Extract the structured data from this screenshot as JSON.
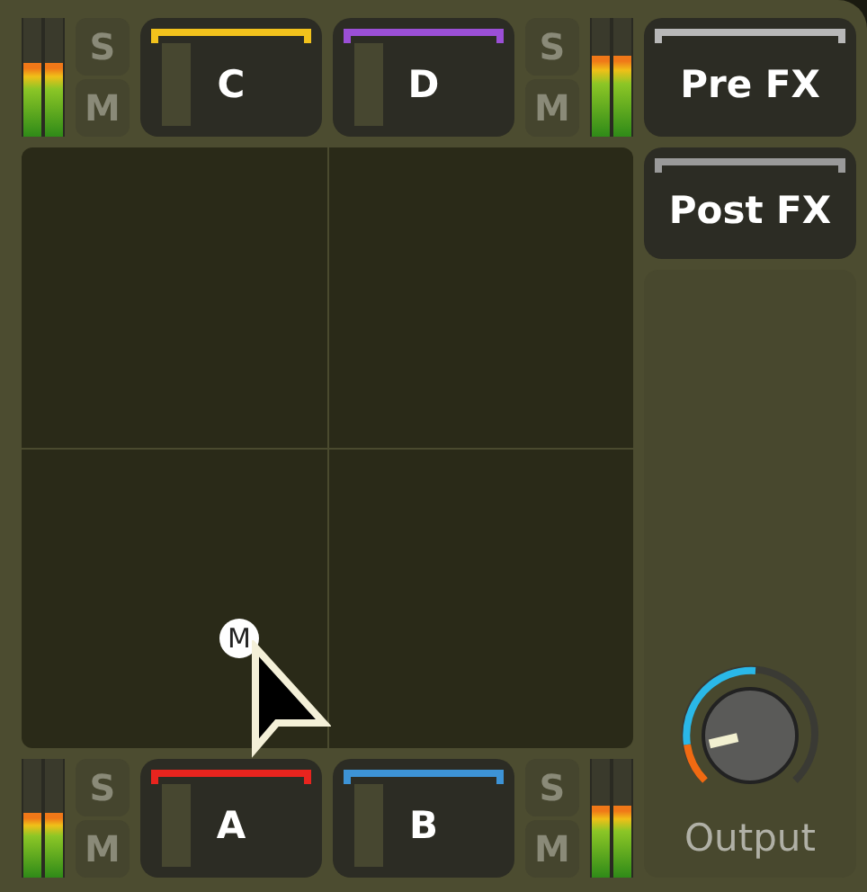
{
  "top_row": {
    "left_meter": [
      {
        "level": 0.62
      },
      {
        "level": 0.62
      }
    ],
    "left_solo": "S",
    "left_mute": "M",
    "pads": [
      {
        "label": "C",
        "color": "#f2c21c"
      },
      {
        "label": "D",
        "color": "#9b4fd6"
      }
    ],
    "right_solo": "S",
    "right_mute": "M",
    "right_meter": [
      {
        "level": 0.68
      },
      {
        "level": 0.68
      }
    ]
  },
  "pre_fx": {
    "label": "Pre FX",
    "color": "#b8b8b8"
  },
  "post_fx": {
    "label": "Post FX",
    "color": "#9a9a9a"
  },
  "xy_pad": {
    "puck": "M"
  },
  "output": {
    "label": "Output"
  },
  "bottom_row": {
    "left_meter": [
      {
        "level": 0.55
      },
      {
        "level": 0.55
      }
    ],
    "left_solo": "S",
    "left_mute": "M",
    "pads": [
      {
        "label": "A",
        "color": "#e8241e"
      },
      {
        "label": "B",
        "color": "#3d93d6"
      }
    ],
    "right_solo": "S",
    "right_mute": "M",
    "right_meter": [
      {
        "level": 0.6
      },
      {
        "level": 0.6
      }
    ]
  }
}
